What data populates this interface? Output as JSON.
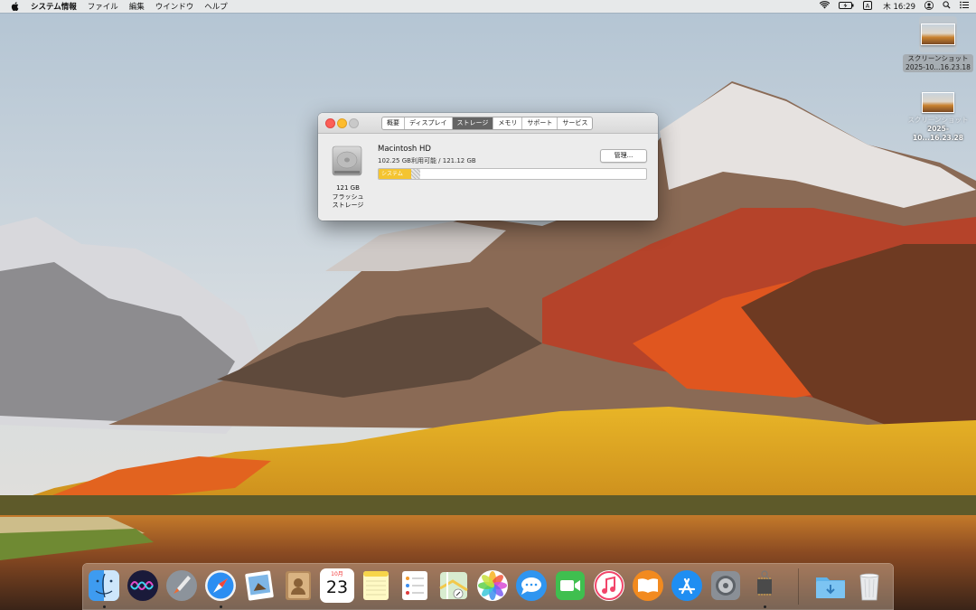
{
  "menubar": {
    "app_name": "システム情報",
    "menus": [
      "ファイル",
      "編集",
      "ウインドウ",
      "ヘルプ"
    ],
    "clock": "木 16:29"
  },
  "desktop": {
    "icons": [
      {
        "line1": "スクリーンショット",
        "line2": "2025-10...16.23.18"
      },
      {
        "line1": "スクリーンショット",
        "line2": "2025-10...16.23.28"
      }
    ]
  },
  "window": {
    "tabs": [
      "概要",
      "ディスプレイ",
      "ストレージ",
      "メモリ",
      "サポート",
      "サービス"
    ],
    "active_tab": "ストレージ",
    "disk": {
      "name": "Macintosh HD",
      "available": "102.25 GB利用可能 / 121.12 GB",
      "caption_size": "121 GB",
      "caption_type1": "フラッシュ",
      "caption_type2": "ストレージ",
      "manage_label": "管理...",
      "system_label": "システム",
      "system_fraction": 0.12,
      "other_fraction": 0.035
    }
  },
  "dock": {
    "calendar_month": "10月",
    "calendar_day": "23",
    "apps": [
      "finder-icon",
      "siri-icon",
      "launchpad-icon",
      "safari-icon",
      "preview-icon",
      "contacts-icon",
      "calendar-icon",
      "notes-icon",
      "reminders-icon",
      "maps-icon",
      "photos-icon",
      "messages-icon",
      "facetime-icon",
      "music-icon",
      "books-icon",
      "app-store-icon",
      "system-preferences-icon",
      "system-information-icon",
      "downloads-folder-icon",
      "trash-icon"
    ]
  },
  "colors": {
    "storage_system": "#f4c430",
    "active_tab": "#646464",
    "close": "#fc5f57",
    "minimize": "#fdbc2e"
  }
}
